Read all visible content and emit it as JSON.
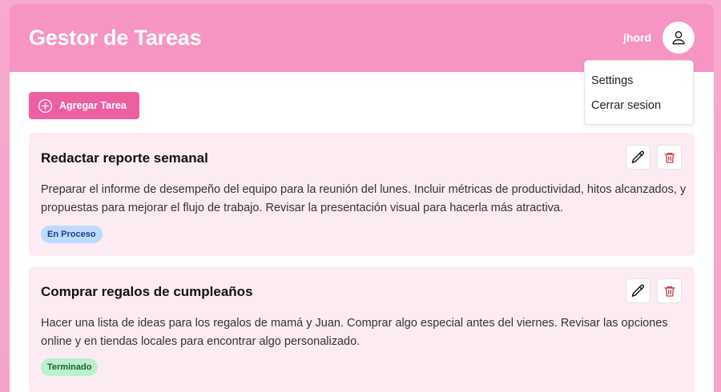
{
  "header": {
    "title": "Gestor de Tareas",
    "username": "jhord",
    "avatar_icon": "user-icon"
  },
  "user_menu": {
    "items": [
      {
        "label": "Settings"
      },
      {
        "label": "Cerrar sesion"
      }
    ]
  },
  "toolbar": {
    "add_label": "Agregar Tarea",
    "add_icon": "plus-circle-icon"
  },
  "tasks": [
    {
      "title": "Redactar reporte semanal",
      "description": "Preparar el informe de desempeño del equipo para la reunión del lunes. Incluir métricas de productividad, hitos alcanzados, y propuestas para mejorar el flujo de trabajo. Revisar la presentación visual para hacerla más atractiva.",
      "status": "En Proceso",
      "status_color": "#bedaff"
    },
    {
      "title": "Comprar regalos de cumpleaños",
      "description": "Hacer una lista de ideas para los regalos de mamá y Juan. Comprar algo especial antes del viernes. Revisar las opciones online y en tiendas locales para encontrar algo personalizado.",
      "status": "Terminado",
      "status_color": "#b9f1cc"
    }
  ],
  "colors": {
    "header_bg": "#f695c3",
    "accent": "#ee5fa1",
    "card_bg": "#fdebf3",
    "delete_icon": "#d0354a"
  }
}
